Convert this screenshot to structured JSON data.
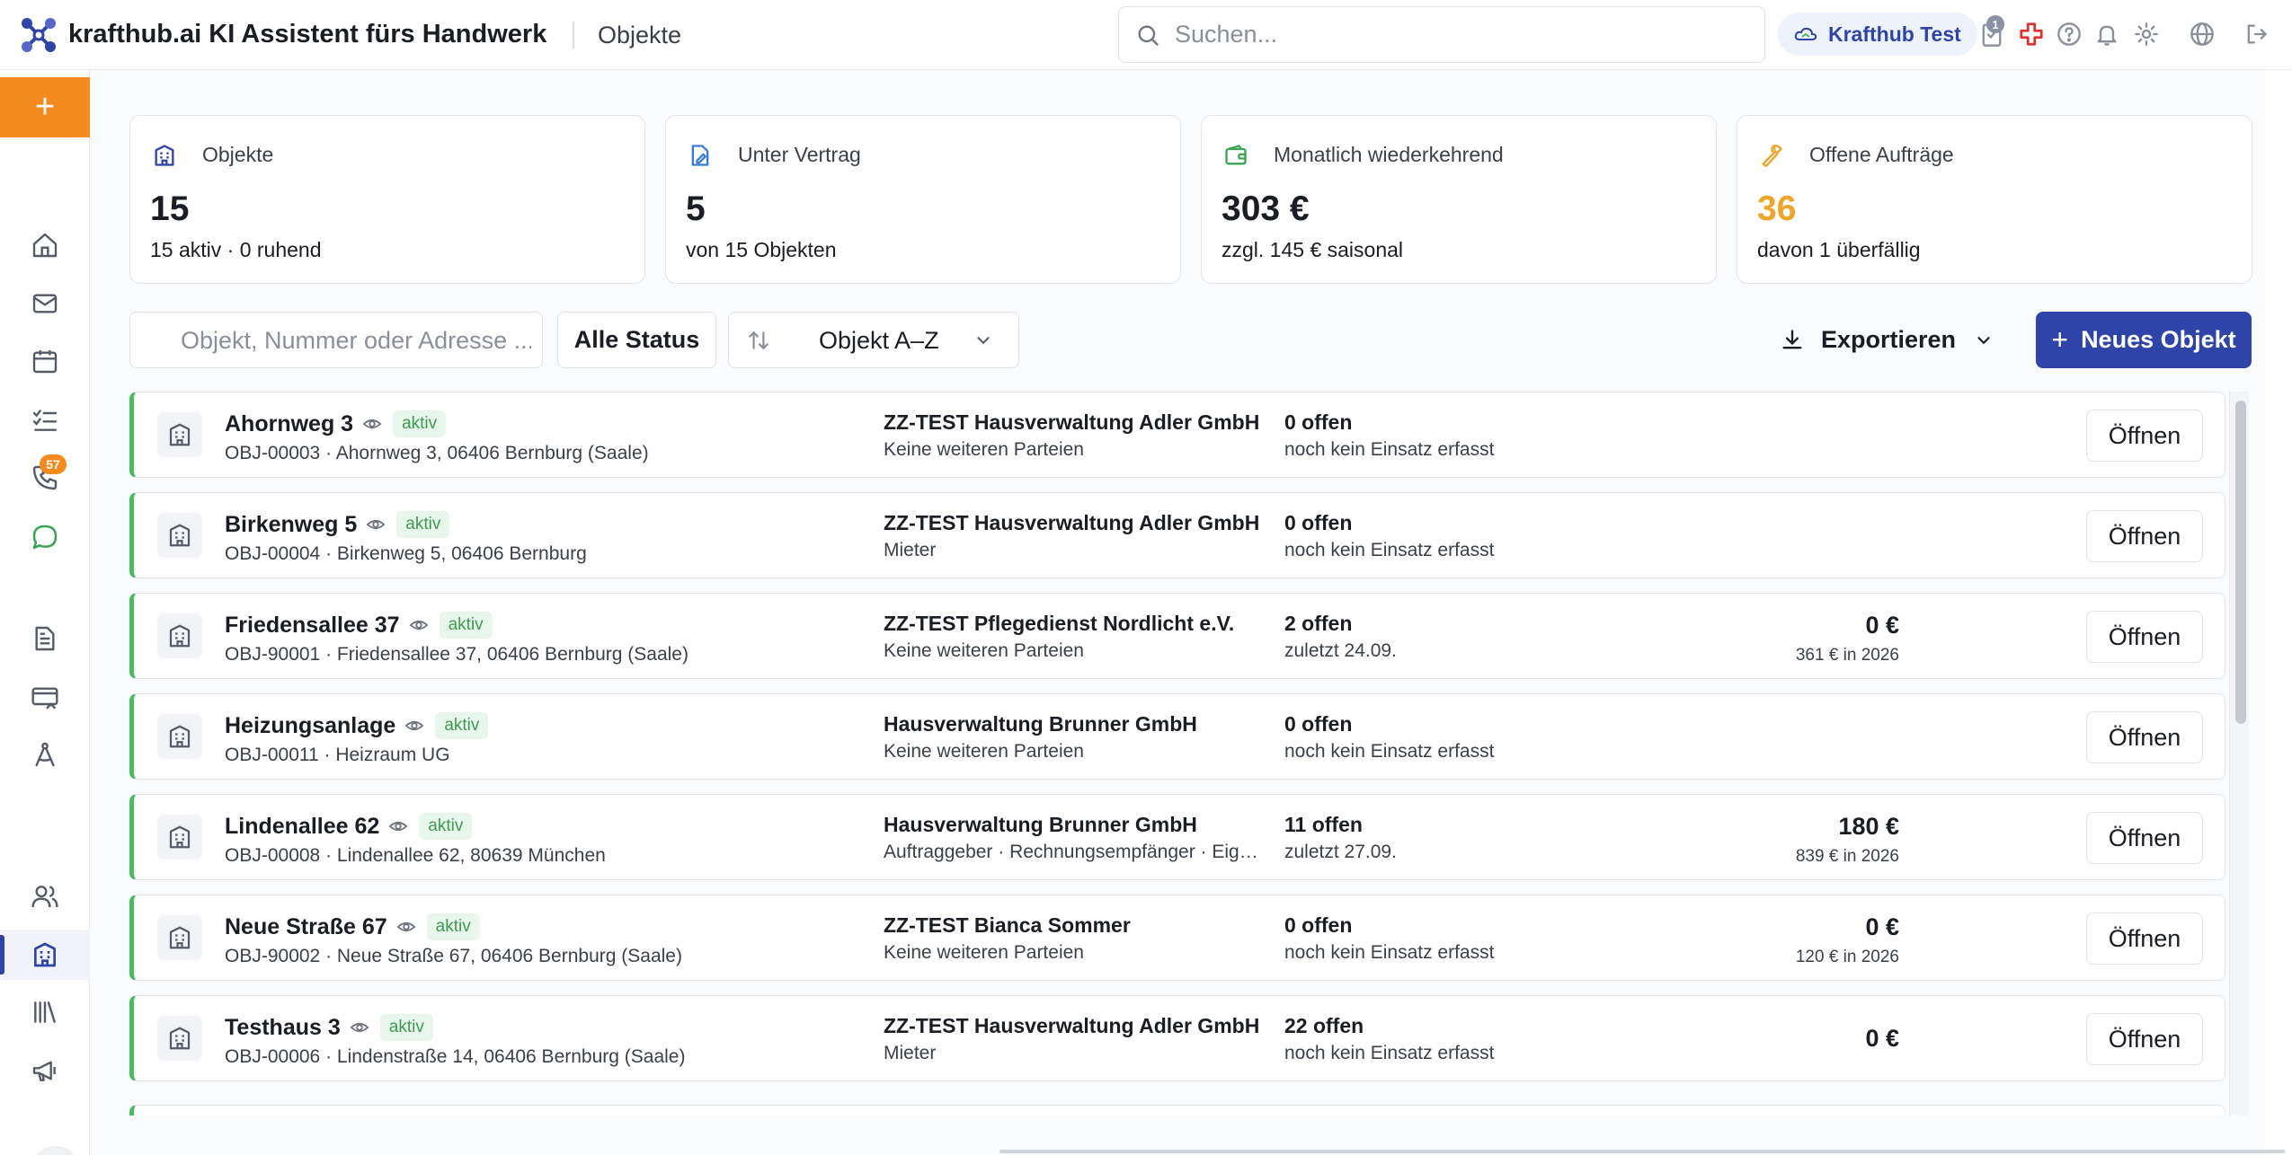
{
  "header": {
    "app_title": "krafthub.ai KI Assistent fürs Handwerk",
    "breadcrumb": "Objekte",
    "search_placeholder": "Suchen...",
    "tenant_name": "Krafthub Test",
    "notification_count": "1"
  },
  "sidebar": {
    "add_label": "+",
    "calls_badge": "57"
  },
  "stats": [
    {
      "label": "Objekte",
      "value": "15",
      "sub": "15 aktiv · 0 ruhend",
      "icon": "building-icon"
    },
    {
      "label": "Unter Vertrag",
      "value": "5",
      "sub": "von 15 Objekten",
      "icon": "contract-edit-icon"
    },
    {
      "label": "Monatlich wiederkehrend",
      "value": "303 €",
      "sub": "zzgl. 145 € saisonal",
      "icon": "wallet-icon"
    },
    {
      "label": "Offene Aufträge",
      "value": "36",
      "sub": "davon 1 überfällig",
      "icon": "wrench-icon"
    }
  ],
  "filters": {
    "search_placeholder": "Objekt, Nummer oder Adresse ...",
    "status_label": "Alle Status",
    "sort_label": "Objekt A–Z",
    "export_label": "Exportieren",
    "new_label": "Neues Objekt"
  },
  "objects": [
    {
      "name": "Ahornweg 3",
      "status": "aktiv",
      "meta": "OBJ-00003 · Ahornweg 3, 06406 Bernburg (Saale)",
      "client": "ZZ-TEST Hausverwaltung Adler GmbH",
      "parties": "Keine weiteren Parteien",
      "open": "0 offen",
      "last": "noch kein Einsatz erfasst",
      "amount": "",
      "year": "",
      "action": "Öffnen"
    },
    {
      "name": "Birkenweg 5",
      "status": "aktiv",
      "meta": "OBJ-00004 · Birkenweg 5, 06406 Bernburg",
      "client": "ZZ-TEST Hausverwaltung Adler GmbH",
      "parties": "Mieter",
      "open": "0 offen",
      "last": "noch kein Einsatz erfasst",
      "amount": "",
      "year": "",
      "action": "Öffnen"
    },
    {
      "name": "Friedensallee 37",
      "status": "aktiv",
      "meta": "OBJ-90001 · Friedensallee 37, 06406 Bernburg (Saale)",
      "client": "ZZ-TEST Pflegedienst Nordlicht e.V.",
      "parties": "Keine weiteren Parteien",
      "open": "2 offen",
      "last": "zuletzt 24.09.",
      "amount": "0 €",
      "year": "361 € in 2026",
      "action": "Öffnen"
    },
    {
      "name": "Heizungsanlage",
      "status": "aktiv",
      "meta": "OBJ-00011 · Heizraum UG",
      "client": "Hausverwaltung Brunner GmbH",
      "parties": "Keine weiteren Parteien",
      "open": "0 offen",
      "last": "noch kein Einsatz erfasst",
      "amount": "",
      "year": "",
      "action": "Öffnen"
    },
    {
      "name": "Lindenallee 62",
      "status": "aktiv",
      "meta": "OBJ-00008 · Lindenallee 62, 80639 München",
      "client": "Hausverwaltung Brunner GmbH",
      "parties": "Auftraggeber · Rechnungsempfänger · Eigentümer",
      "open": "11 offen",
      "last": "zuletzt 27.09.",
      "amount": "180 €",
      "year": "839 € in 2026",
      "action": "Öffnen"
    },
    {
      "name": "Neue Straße 67",
      "status": "aktiv",
      "meta": "OBJ-90002 · Neue Straße 67, 06406 Bernburg (Saale)",
      "client": "ZZ-TEST Bianca Sommer",
      "parties": "Keine weiteren Parteien",
      "open": "0 offen",
      "last": "noch kein Einsatz erfasst",
      "amount": "0 €",
      "year": "120 € in 2026",
      "action": "Öffnen"
    },
    {
      "name": "Testhaus 3",
      "status": "aktiv",
      "meta": "OBJ-00006 · Lindenstraße 14, 06406 Bernburg (Saale)",
      "client": "ZZ-TEST Hausverwaltung Adler GmbH",
      "parties": "Mieter",
      "open": "22 offen",
      "last": "noch kein Einsatz erfasst",
      "amount": "0 €",
      "year": "",
      "action": "Öffnen"
    }
  ],
  "colors": {
    "brand": "#2f44a8",
    "accent": "#f58a1f",
    "status_active": "#4cbb5f",
    "highlight_value": "#eda52a"
  }
}
